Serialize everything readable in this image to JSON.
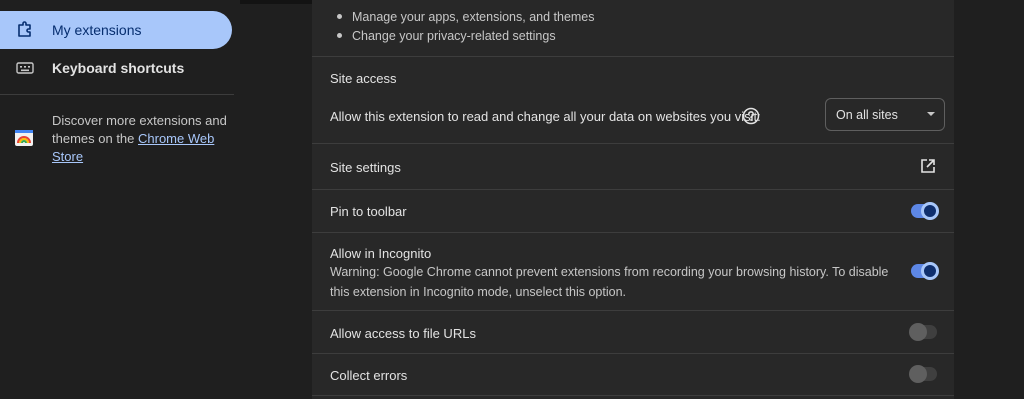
{
  "sidebar": {
    "items": [
      {
        "label": "My extensions",
        "icon": "puzzle-icon"
      },
      {
        "label": "Keyboard shortcuts",
        "icon": "keyboard-icon"
      }
    ],
    "discover_text": "Discover more extensions and themes on the ",
    "discover_link": "Chrome Web Store"
  },
  "permissions": {
    "items": [
      "Manage your apps, extensions, and themes",
      "Change your privacy-related settings"
    ]
  },
  "site_access": {
    "heading": "Site access",
    "description": "Allow this extension to read and change all your data on websites you visit:",
    "selected": "On all sites"
  },
  "rows": {
    "site_settings": "Site settings",
    "pin_to_toolbar": {
      "label": "Pin to toolbar",
      "enabled": true
    },
    "incognito": {
      "label": "Allow in Incognito",
      "warning": "Warning: Google Chrome cannot prevent extensions from recording your browsing history. To disable this extension in Incognito mode, unselect this option.",
      "enabled": true
    },
    "file_urls": {
      "label": "Allow access to file URLs",
      "enabled": false
    },
    "collect_errors": {
      "label": "Collect errors",
      "enabled": false
    }
  },
  "colors": {
    "accent": "#a8c7fa",
    "toggle_on": "#5d87e6",
    "card": "#282828",
    "background": "#1f1f1f"
  }
}
